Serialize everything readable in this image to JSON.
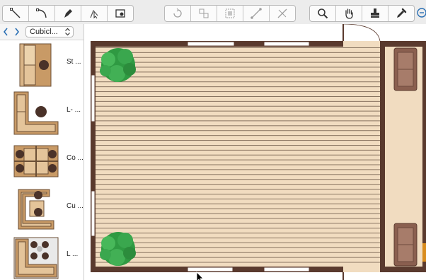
{
  "toolbar": {
    "group1": [
      {
        "icon": "line-tool-icon"
      },
      {
        "icon": "arc-tool-icon"
      },
      {
        "icon": "pen-tool-icon"
      },
      {
        "icon": "direct-select-icon"
      },
      {
        "icon": "insert-shape-icon"
      }
    ],
    "group2": [
      {
        "icon": "rotate-icon"
      },
      {
        "icon": "align-icon"
      },
      {
        "icon": "group-icon"
      },
      {
        "icon": "connector-icon"
      },
      {
        "icon": "disconnect-icon"
      }
    ],
    "group3": [
      {
        "icon": "zoom-icon"
      },
      {
        "icon": "hand-pan-icon"
      },
      {
        "icon": "stamp-icon"
      },
      {
        "icon": "eyedropper-icon"
      }
    ]
  },
  "library": {
    "selected": "Cubicl...",
    "items": [
      {
        "label": "St ..."
      },
      {
        "label": "L- ..."
      },
      {
        "label": "Co ..."
      },
      {
        "label": "Cu ..."
      },
      {
        "label": "L ..."
      }
    ]
  },
  "colors": {
    "wall": "#5a3a2e",
    "floor": "#f1dcc0",
    "plank_line": "#6e5a48",
    "window": "#ffffff",
    "chair": "#8a5f4f",
    "plant": "#2f9a42",
    "accent_blue": "#2a6fb4"
  }
}
